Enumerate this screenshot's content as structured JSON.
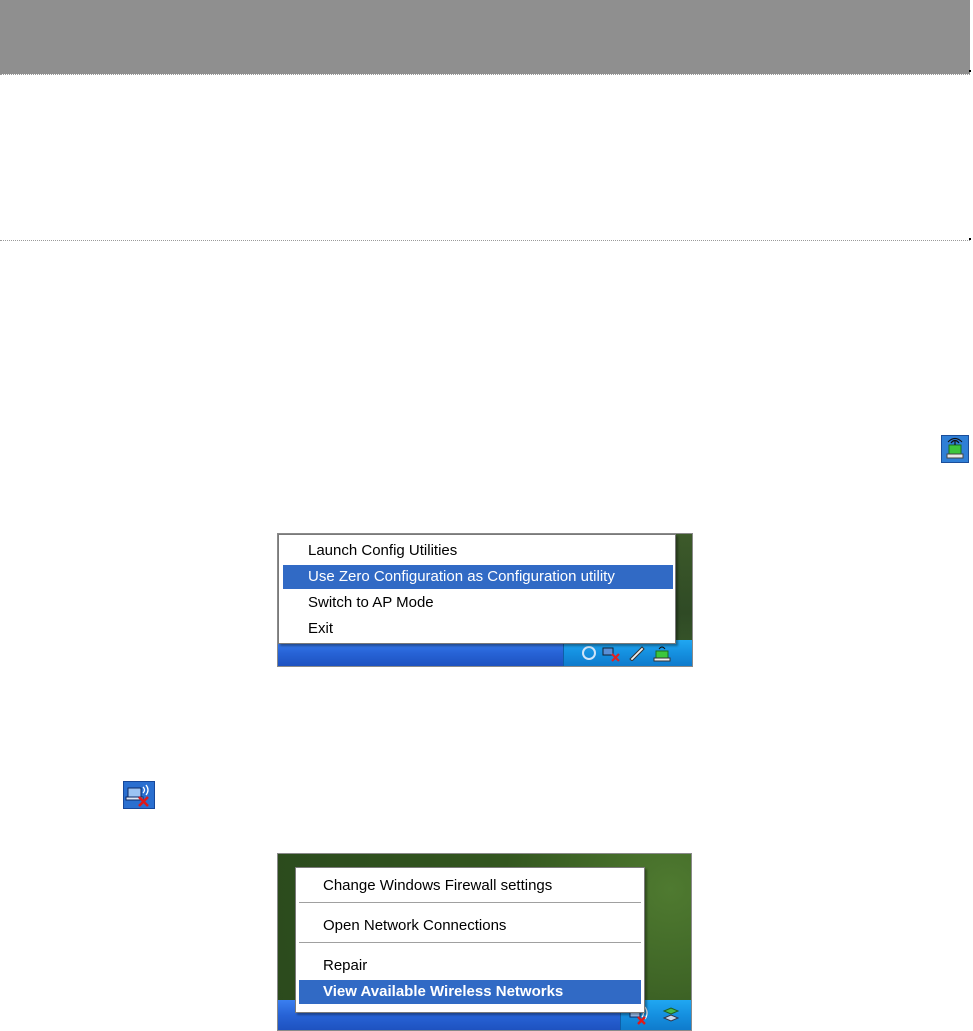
{
  "menu_taskbar_utility": {
    "items": [
      {
        "label": "Launch Config Utilities",
        "highlighted": false
      },
      {
        "label": "Use Zero Configuration as Configuration utility",
        "highlighted": true
      },
      {
        "label": "Switch to AP Mode",
        "highlighted": false
      },
      {
        "label": "Exit",
        "highlighted": false
      }
    ]
  },
  "menu_wireless_connection": {
    "items": [
      {
        "label": "Change Windows Firewall settings",
        "highlighted": false
      },
      {
        "label": "Open Network Connections",
        "highlighted": false
      },
      {
        "label": "Repair",
        "highlighted": false
      },
      {
        "label": "View Available Wireless Networks",
        "highlighted": true
      }
    ]
  },
  "icons": {
    "utility_tray": "ralink-utility-icon",
    "wireless_tray": "wireless-network-disconnected-icon"
  },
  "colors": {
    "header_bar": "#8f8f8f",
    "menu_highlight": "#316ac5",
    "taskbar": "#2763d6",
    "tray": "#1590e0"
  }
}
